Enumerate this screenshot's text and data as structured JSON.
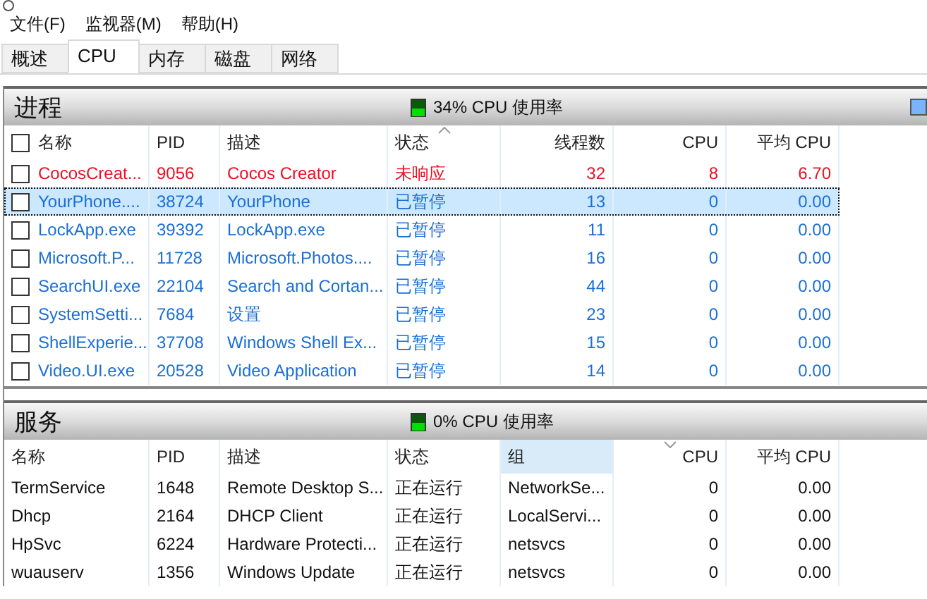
{
  "menu": [
    "文件(F)",
    "监视器(M)",
    "帮助(H)"
  ],
  "tabs": [
    {
      "label": "概述",
      "selected": false
    },
    {
      "label": "CPU",
      "selected": true
    },
    {
      "label": "内存",
      "selected": false
    },
    {
      "label": "磁盘",
      "selected": false
    },
    {
      "label": "网络",
      "selected": false
    }
  ],
  "processes": {
    "title": "进程",
    "usage": "34% CPU 使用率",
    "all_checked": false,
    "columns": [
      {
        "label": "名称"
      },
      {
        "label": "PID"
      },
      {
        "label": "描述"
      },
      {
        "label": "状态",
        "sorted": true,
        "descending": false
      },
      {
        "label": "线程数"
      },
      {
        "label": "CPU"
      },
      {
        "label": "平均 CPU"
      }
    ],
    "rows": [
      {
        "kind": "not_responding",
        "selected": false,
        "checked": false,
        "cells": [
          "CocosCreat...",
          "9056",
          "Cocos Creator",
          "未响应",
          "32",
          "8",
          "6.70"
        ]
      },
      {
        "kind": "suspended",
        "selected": true,
        "checked": false,
        "cells": [
          "YourPhone....",
          "38724",
          "YourPhone",
          "已暂停",
          "13",
          "0",
          "0.00"
        ]
      },
      {
        "kind": "suspended",
        "selected": false,
        "checked": false,
        "cells": [
          "LockApp.exe",
          "39392",
          "LockApp.exe",
          "已暂停",
          "11",
          "0",
          "0.00"
        ]
      },
      {
        "kind": "suspended",
        "selected": false,
        "checked": false,
        "cells": [
          "Microsoft.P...",
          "11728",
          "Microsoft.Photos....",
          "已暂停",
          "16",
          "0",
          "0.00"
        ]
      },
      {
        "kind": "suspended",
        "selected": false,
        "checked": false,
        "cells": [
          "SearchUI.exe",
          "22104",
          "Search and Cortan...",
          "已暂停",
          "44",
          "0",
          "0.00"
        ]
      },
      {
        "kind": "suspended",
        "selected": false,
        "checked": false,
        "cells": [
          "SystemSetti...",
          "7684",
          "设置",
          "已暂停",
          "23",
          "0",
          "0.00"
        ]
      },
      {
        "kind": "suspended",
        "selected": false,
        "checked": false,
        "cells": [
          "ShellExperie...",
          "37708",
          "Windows Shell Ex...",
          "已暂停",
          "15",
          "0",
          "0.00"
        ]
      },
      {
        "kind": "suspended",
        "selected": false,
        "checked": false,
        "cells": [
          "Video.UI.exe",
          "20528",
          "Video Application",
          "已暂停",
          "14",
          "0",
          "0.00"
        ]
      }
    ]
  },
  "services": {
    "title": "服务",
    "usage": "0% CPU 使用率",
    "columns": [
      {
        "label": "名称"
      },
      {
        "label": "PID"
      },
      {
        "label": "描述"
      },
      {
        "label": "状态"
      },
      {
        "label": "组",
        "highlighted": true
      },
      {
        "label": "CPU",
        "sorted": true,
        "descending": true
      },
      {
        "label": "平均 CPU"
      }
    ],
    "rows": [
      {
        "cells": [
          "TermService",
          "1648",
          "Remote Desktop S...",
          "正在运行",
          "NetworkSe...",
          "0",
          "0.00"
        ]
      },
      {
        "cells": [
          "Dhcp",
          "2164",
          "DHCP Client",
          "正在运行",
          "LocalServi...",
          "0",
          "0.00"
        ]
      },
      {
        "cells": [
          "HpSvc",
          "6224",
          "Hardware Protecti...",
          "正在运行",
          "netsvcs",
          "0",
          "0.00"
        ]
      },
      {
        "cells": [
          "wuauserv",
          "1356",
          "Windows Update",
          "正在运行",
          "netsvcs",
          "0",
          "0.00"
        ]
      }
    ]
  }
}
